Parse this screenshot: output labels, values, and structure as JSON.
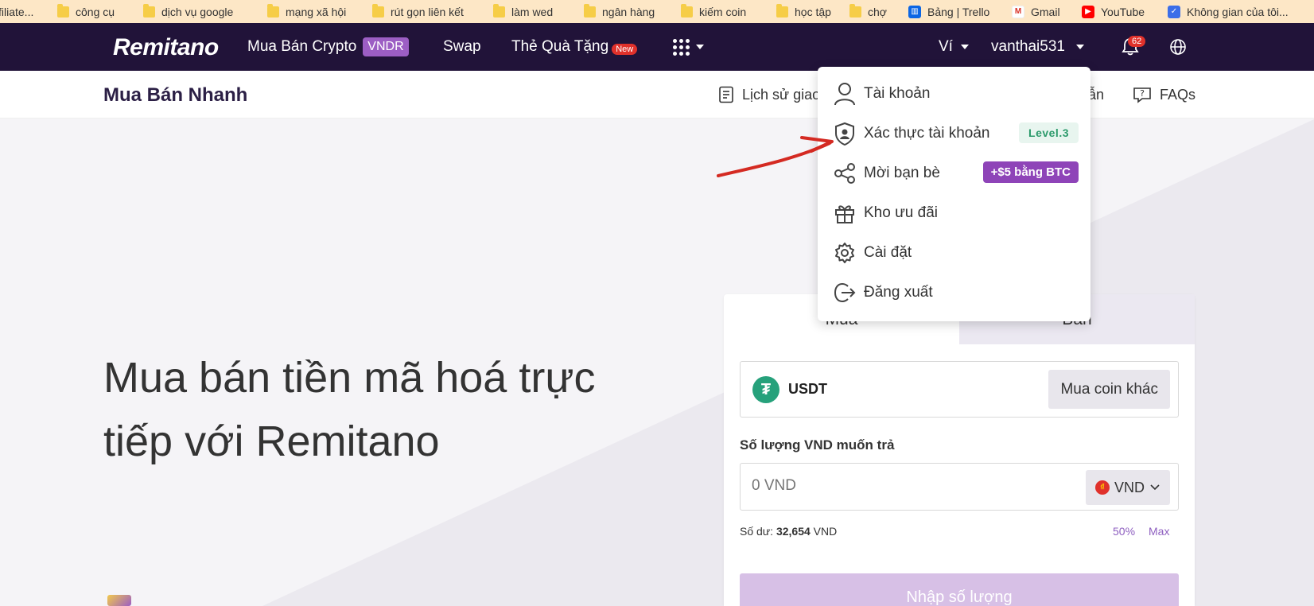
{
  "bookmarks": [
    {
      "label": "filiate...",
      "icon": "link-icon"
    },
    {
      "label": "công cụ",
      "icon": "folder-icon"
    },
    {
      "label": "dịch vụ google",
      "icon": "folder-icon"
    },
    {
      "label": "mạng xã hội",
      "icon": "folder-icon"
    },
    {
      "label": "rút gọn liên kết",
      "icon": "folder-icon"
    },
    {
      "label": "làm wed",
      "icon": "folder-icon"
    },
    {
      "label": "ngân hàng",
      "icon": "folder-icon"
    },
    {
      "label": "kiếm coin",
      "icon": "folder-icon"
    },
    {
      "label": "học tập",
      "icon": "folder-icon"
    },
    {
      "label": "chợ",
      "icon": "folder-icon"
    },
    {
      "label": "Bảng | Trello",
      "icon": "trello-icon"
    },
    {
      "label": "Gmail",
      "icon": "gmail-icon"
    },
    {
      "label": "YouTube",
      "icon": "youtube-icon"
    },
    {
      "label": "Không gian của tôi...",
      "icon": "space-icon"
    }
  ],
  "nav": {
    "logo": "Remitano",
    "buy_sell": "Mua Bán Crypto",
    "vndr": "VNDR",
    "swap": "Swap",
    "gift_card": "Thẻ Quà Tặng",
    "new_badge": "New",
    "wallet": "Ví",
    "username": "vanthai531",
    "notifications": "62"
  },
  "subheader": {
    "title": "Mua Bán Nhanh",
    "history": "Lịch sử giao",
    "guide": "ẫn",
    "faqs": "FAQs"
  },
  "hero": {
    "title_line1": "Mua bán tiền mã hoá trực",
    "title_line2": "tiếp với Remitano"
  },
  "trade": {
    "tab_buy": "Mua",
    "tab_sell": "Bán",
    "coin": "USDT",
    "other_coin": "Mua coin khác",
    "amount_label": "Số lượng VND muốn trả",
    "amount_placeholder": "0 VND",
    "currency": "VND",
    "balance_label": "Số dư:",
    "balance_value": "32,654",
    "balance_unit": "VND",
    "pct_50": "50%",
    "max": "Max",
    "submit": "Nhập số lượng"
  },
  "account_menu": {
    "items": [
      {
        "label": "Tài khoản",
        "icon": "user-icon"
      },
      {
        "label": "Xác thực tài khoản",
        "icon": "shield-user-icon",
        "badge": "Level.3"
      },
      {
        "label": "Mời bạn bè",
        "icon": "share-icon",
        "badge": "+$5 bằng BTC"
      },
      {
        "label": "Kho ưu đãi",
        "icon": "gift-icon"
      },
      {
        "label": "Cài đặt",
        "icon": "gear-icon"
      },
      {
        "label": "Đăng xuất",
        "icon": "logout-icon"
      }
    ]
  },
  "colors": {
    "nav_bg": "#211339",
    "accent": "#9c5ec4",
    "bookmark_bar": "#fde7c6",
    "annotation_arrow": "#d42a22"
  }
}
